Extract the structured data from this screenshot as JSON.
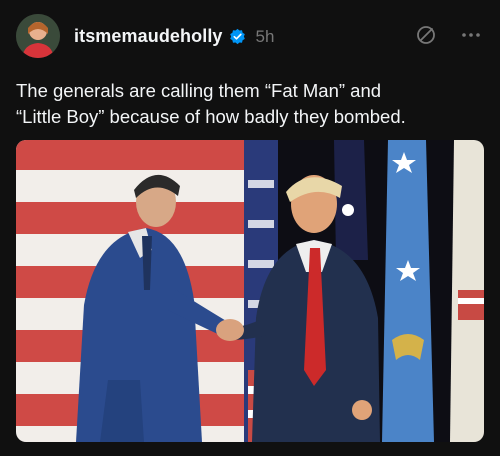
{
  "post": {
    "username": "itsmemaudeholly",
    "time_ago": "5h",
    "caption_line1": "The generals are calling them “Fat Man” and",
    "caption_line2": "“Little Boy” because of how badly they bombed.",
    "verified_icon": "verified-badge-icon",
    "media_icons": [
      "us-flag",
      "blue-flag",
      "dark-flag"
    ]
  },
  "colors": {
    "background": "#101010",
    "text_primary": "#f3f5f7",
    "text_secondary": "#777777",
    "verified": "#0095f6"
  }
}
